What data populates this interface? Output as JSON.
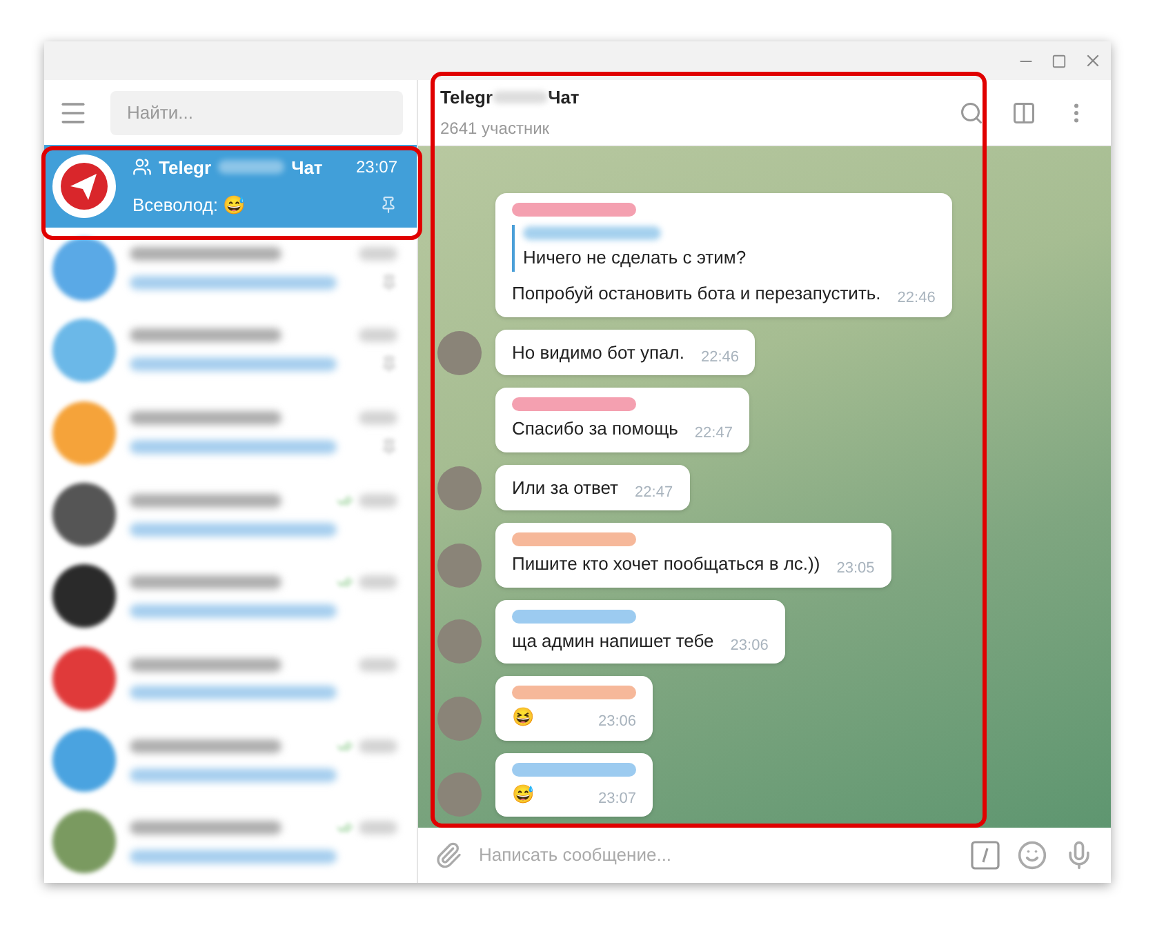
{
  "search": {
    "placeholder": "Найти..."
  },
  "selected_chat": {
    "title_start": "Telegr",
    "title_end": "Чат",
    "time": "23:07",
    "preview": "Всеволод: 😅",
    "selected": true,
    "pinned": true
  },
  "blurred_chats": [
    {
      "color": "#5aa9e6",
      "pinned": true,
      "read": false
    },
    {
      "color": "#6bb8e8",
      "pinned": true,
      "read": false
    },
    {
      "color": "#f5a33a",
      "pinned": true,
      "read": false
    },
    {
      "color": "#555555",
      "pinned": false,
      "read": true
    },
    {
      "color": "#2a2a2a",
      "pinned": false,
      "read": true
    },
    {
      "color": "#e03a3a",
      "pinned": false,
      "read": false
    },
    {
      "color": "#4aa3e0",
      "pinned": false,
      "read": true
    },
    {
      "color": "#7a9a60",
      "pinned": false,
      "read": true
    }
  ],
  "chat_header": {
    "title_start": "Telegr",
    "title_end": "Чат",
    "subtitle": "2641 участник"
  },
  "messages": [
    {
      "kind": "reply",
      "color": "#f4a0b0",
      "reply_text": "Ничего не сделать с этим?",
      "text": "Попробуй остановить бота и перезапустить.",
      "time": "22:46",
      "avatar": false
    },
    {
      "kind": "plain",
      "text": "Но видимо бот упал.",
      "time": "22:46",
      "avatar": true
    },
    {
      "kind": "named",
      "color": "#f4a0b0",
      "text": "Спасибо за помощь",
      "time": "22:47",
      "avatar": false
    },
    {
      "kind": "plain",
      "text": "Или за ответ",
      "time": "22:47",
      "avatar": true
    },
    {
      "kind": "named",
      "color": "#f6b89a",
      "text": "Пишите кто хочет пообщаться в лс.))",
      "time": "23:05",
      "avatar": true
    },
    {
      "kind": "named",
      "color": "#9ccbf0",
      "text": "ща админ напишет тебе",
      "time": "23:06",
      "avatar": true
    },
    {
      "kind": "named",
      "color": "#f6b89a",
      "text": "😆",
      "time": "23:06",
      "avatar": true
    },
    {
      "kind": "named",
      "color": "#9ccbf0",
      "text": "😅",
      "time": "23:07",
      "avatar": true
    }
  ],
  "composer": {
    "placeholder": "Написать сообщение..."
  }
}
